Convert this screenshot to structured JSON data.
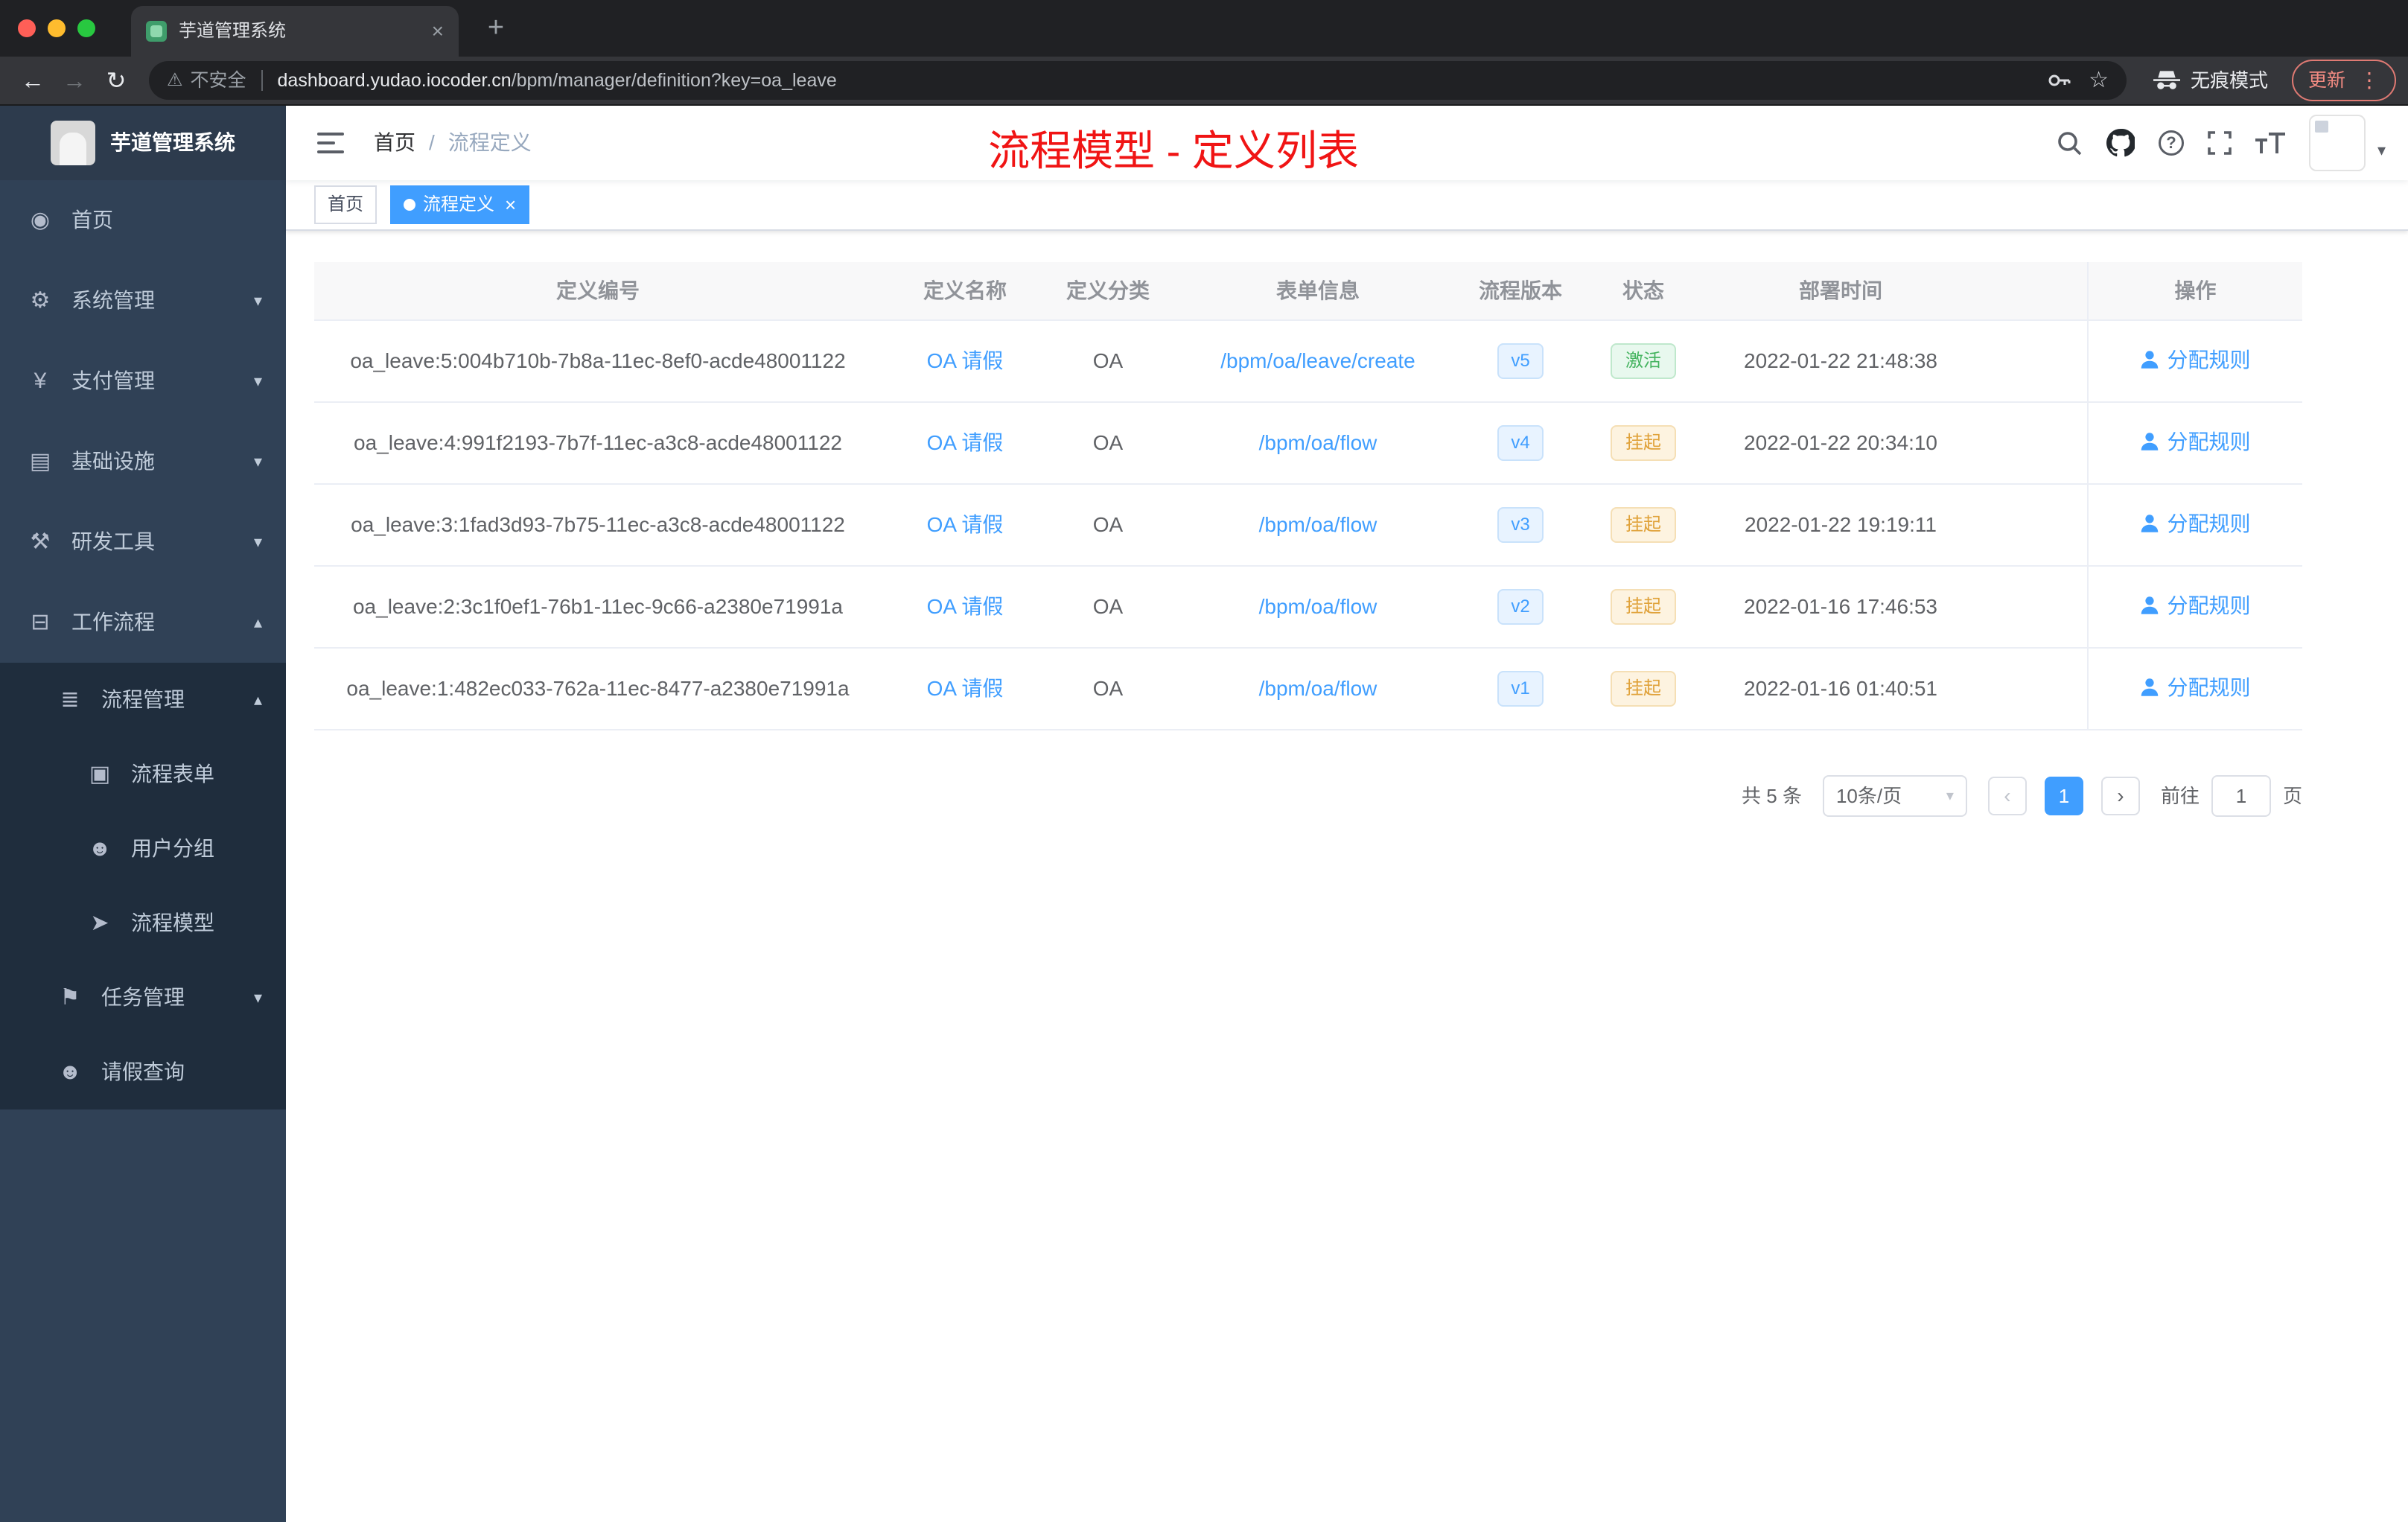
{
  "browser": {
    "tab_title": "芋道管理系统",
    "close_tab": "×",
    "new_tab": "+",
    "back": "←",
    "forward": "→",
    "reload": "↻",
    "warning_icon": "⚠",
    "security_warning": "不安全",
    "url_host": "dashboard.yudao.iocoder.cn",
    "url_path": "/bpm/manager/definition?key=oa_leave",
    "star": "☆",
    "incognito_label": "无痕模式",
    "update_label": "更新",
    "menu_kebab": "⋮"
  },
  "sidebar": {
    "logo_title": "芋道管理系统",
    "menu": [
      {
        "label": "首页",
        "icon": "◉"
      },
      {
        "label": "系统管理",
        "icon": "⚙",
        "chevron": "▾"
      },
      {
        "label": "支付管理",
        "icon": "¥",
        "chevron": "▾"
      },
      {
        "label": "基础设施",
        "icon": "▤",
        "chevron": "▾"
      },
      {
        "label": "研发工具",
        "icon": "⚒",
        "chevron": "▾"
      },
      {
        "label": "工作流程",
        "icon": "⊟",
        "chevron": "▴"
      },
      {
        "label": "流程管理",
        "icon": "≣",
        "chevron": "▴"
      },
      {
        "label": "流程表单",
        "icon": "▣"
      },
      {
        "label": "用户分组",
        "icon": "☻"
      },
      {
        "label": "流程模型",
        "icon": "➤"
      },
      {
        "label": "任务管理",
        "icon": "⚑",
        "chevron": "▾"
      },
      {
        "label": "请假查询",
        "icon": "☻"
      }
    ]
  },
  "header": {
    "breadcrumb_home": "首页",
    "breadcrumb_sep": "/",
    "breadcrumb_current": "流程定义",
    "annotation": "流程模型 - 定义列表",
    "help": "?",
    "avatar_caret": "▾"
  },
  "tags": {
    "home": "首页",
    "current": "流程定义",
    "close": "×"
  },
  "table": {
    "columns": [
      "定义编号",
      "定义名称",
      "定义分类",
      "表单信息",
      "流程版本",
      "状态",
      "部署时间",
      "操作"
    ],
    "rows": [
      {
        "id": "oa_leave:5:004b710b-7b8a-11ec-8ef0-acde48001122",
        "name": "OA 请假",
        "category": "OA",
        "form": "/bpm/oa/leave/create",
        "version": "v5",
        "status": "激活",
        "status_type": "active",
        "time": "2022-01-22 21:48:38",
        "action": "分配规则"
      },
      {
        "id": "oa_leave:4:991f2193-7b7f-11ec-a3c8-acde48001122",
        "name": "OA 请假",
        "category": "OA",
        "form": "/bpm/oa/flow",
        "version": "v4",
        "status": "挂起",
        "status_type": "suspended",
        "time": "2022-01-22 20:34:10",
        "action": "分配规则"
      },
      {
        "id": "oa_leave:3:1fad3d93-7b75-11ec-a3c8-acde48001122",
        "name": "OA 请假",
        "category": "OA",
        "form": "/bpm/oa/flow",
        "version": "v3",
        "status": "挂起",
        "status_type": "suspended",
        "time": "2022-01-22 19:19:11",
        "action": "分配规则"
      },
      {
        "id": "oa_leave:2:3c1f0ef1-76b1-11ec-9c66-a2380e71991a",
        "name": "OA 请假",
        "category": "OA",
        "form": "/bpm/oa/flow",
        "version": "v2",
        "status": "挂起",
        "status_type": "suspended",
        "time": "2022-01-16 17:46:53",
        "action": "分配规则"
      },
      {
        "id": "oa_leave:1:482ec033-762a-11ec-8477-a2380e71991a",
        "name": "OA 请假",
        "category": "OA",
        "form": "/bpm/oa/flow",
        "version": "v1",
        "status": "挂起",
        "status_type": "suspended",
        "time": "2022-01-16 01:40:51",
        "action": "分配规则"
      }
    ]
  },
  "pagination": {
    "total": "共 5 条",
    "page_size": "10条/页",
    "caret": "▾",
    "prev": "‹",
    "page": "1",
    "next": "›",
    "goto": "前往",
    "unit": "页"
  },
  "colors": {
    "accent_blue": "#409eff",
    "status_active_green": "#44b35f",
    "status_suspended_orange": "#e0a23a",
    "annotation_red": "#f01414",
    "sidebar_bg": "#304156",
    "tag_active_bg": "#409eff"
  }
}
